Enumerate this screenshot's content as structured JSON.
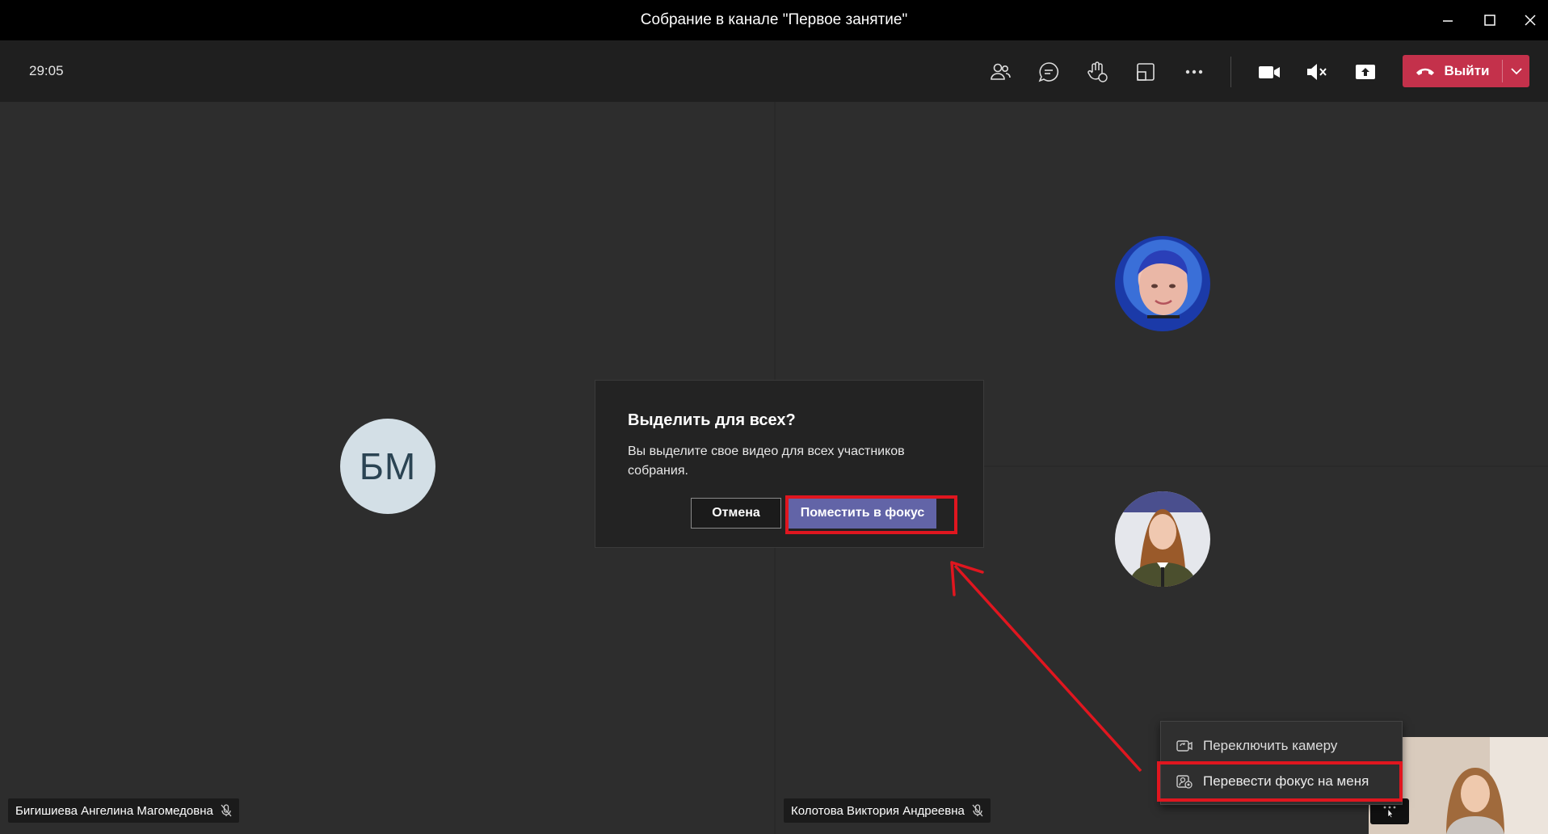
{
  "window": {
    "title": "Собрание в канале \"Первое занятие\"",
    "controls": [
      "minimize-icon",
      "maximize-icon",
      "close-icon"
    ]
  },
  "toolbar": {
    "timer": "29:05",
    "buttons": [
      "participants-icon",
      "chat-icon",
      "reactions-icon",
      "rooms-icon",
      "more-icon",
      "camera-icon",
      "mute-icon",
      "share-icon"
    ],
    "leave_label": "Выйти"
  },
  "tiles": {
    "left": {
      "initials": "БМ",
      "name": "Бигишиева Ангелина Магомедовна"
    },
    "right_bottom": {
      "name": "Колотова Виктория Андреевна"
    }
  },
  "dialog": {
    "title": "Выделить для всех?",
    "text": "Вы выделите свое видео для всех участников собрания.",
    "cancel_label": "Отмена",
    "confirm_label": "Поместить в фокус"
  },
  "context_menu": {
    "items": [
      {
        "label": "Переключить камеру",
        "icon": "switch-camera-icon"
      },
      {
        "label": "Перевести фокус на меня",
        "icon": "spotlight-me-icon"
      }
    ]
  },
  "colors": {
    "leave": "#c4314b",
    "primary": "#6264a7",
    "annotation": "#e0161f"
  }
}
